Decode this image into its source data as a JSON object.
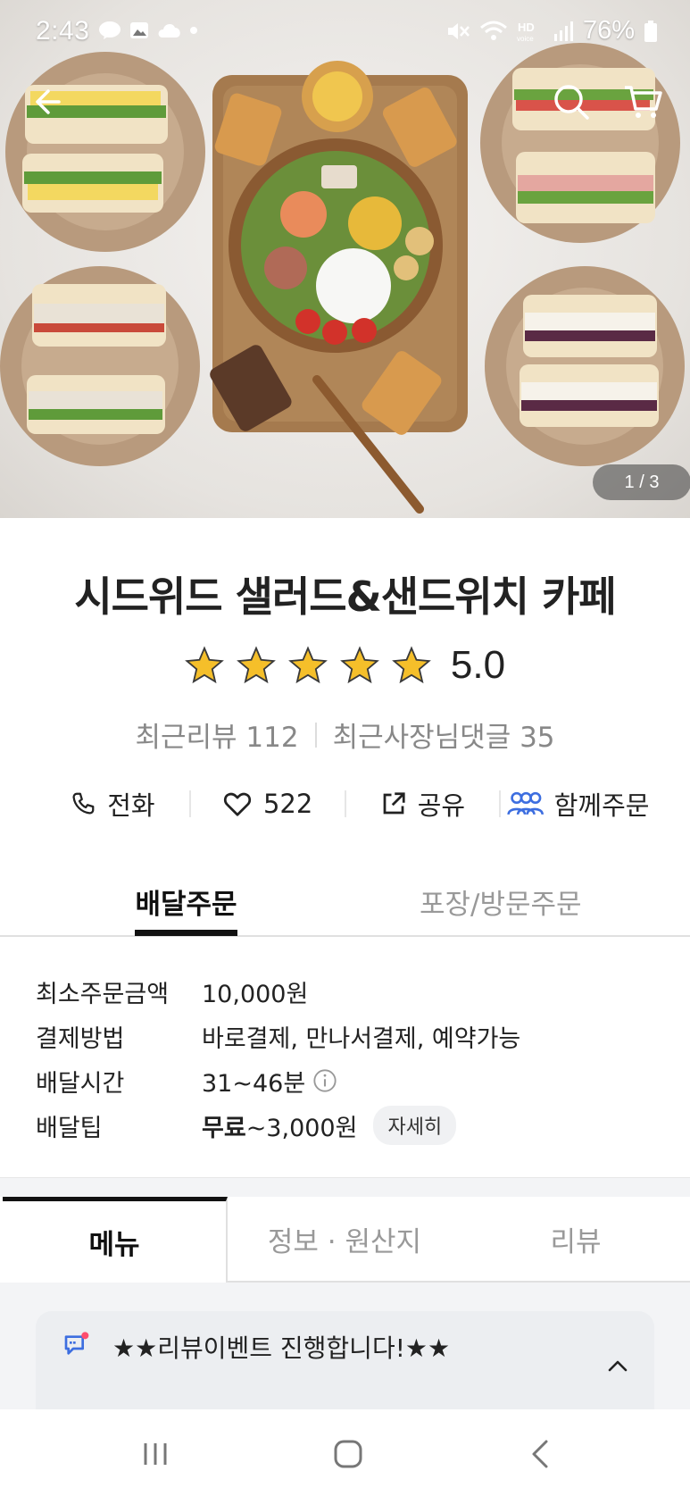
{
  "status_bar": {
    "time": "2:43",
    "battery": "76%",
    "left_icons": [
      "talk-icon",
      "gallery-icon",
      "cloud-icon",
      "dot-icon"
    ],
    "right_icons": [
      "mute-icon",
      "wifi-icon",
      "hd-voice-icon",
      "signal-icon",
      "battery-icon"
    ]
  },
  "hero": {
    "pager": "1 / 3",
    "icons": [
      "back-arrow-icon",
      "search-icon",
      "cart-icon"
    ]
  },
  "store": {
    "name": "시드위드 샐러드&샌드위치 카페",
    "rating": "5.0",
    "stars": 5,
    "recent_reviews": "최근리뷰 112",
    "recent_owner_replies": "최근사장님댓글 35"
  },
  "actions": {
    "call": "전화",
    "likes": "522",
    "share": "공유",
    "group_order": "함께주문"
  },
  "order_tabs": {
    "delivery": "배달주문",
    "pickup": "포장/방문주문"
  },
  "info": {
    "min_order_label": "최소주문금액",
    "min_order_value": "10,000원",
    "payment_label": "결제방법",
    "payment_value": "바로결제, 만나서결제, 예약가능",
    "delivery_time_label": "배달시간",
    "delivery_time_value": "31~46분",
    "delivery_tip_label": "배달팁",
    "delivery_tip_free": "무료",
    "delivery_tip_value": "~3,000원",
    "detail_chip": "자세히"
  },
  "menu_tabs": {
    "menu": "메뉴",
    "info": "정보 · 원산지",
    "reviews": "리뷰"
  },
  "notice": {
    "text": "★★리뷰이벤트 진행합니다!★★"
  },
  "colors": {
    "accent_blue": "#3d6ee0",
    "star_yellow": "#f5bf2a",
    "notice_dot": "#ff4d6d"
  }
}
